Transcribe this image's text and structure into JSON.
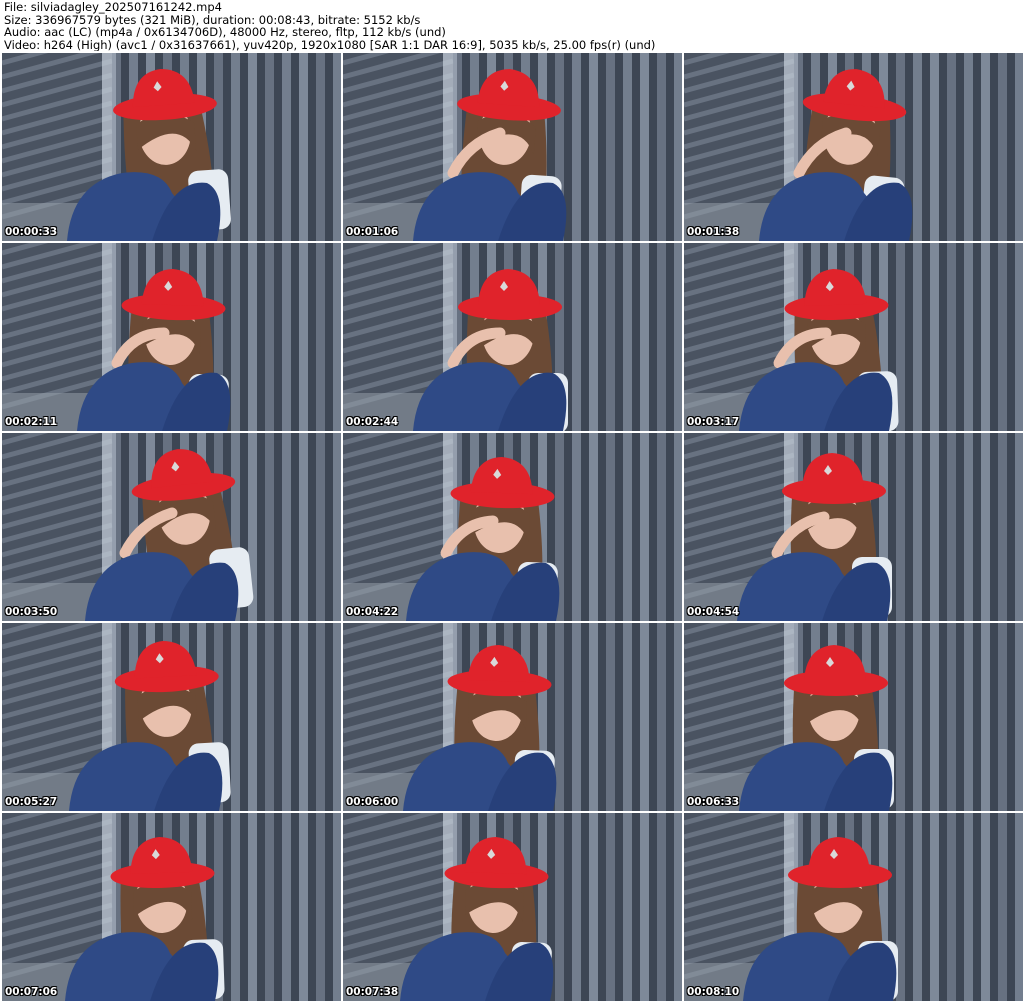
{
  "header": {
    "file_line": "File: silviadagley_202507161242.mp4",
    "size_line": "Size: 336967579 bytes (321 MiB), duration: 00:08:43, bitrate: 5152 kb/s",
    "audio_line": "Audio: aac (LC) (mp4a / 0x6134706D), 48000 Hz, stereo, fltp, 112 kb/s (und)",
    "video_line": "Video: h264 (High) (avc1 / 0x31637661), yuv420p, 1920x1080 [SAR 1:1 DAR 16:9], 5035 kb/s, 25.00 fps(r) (und)"
  },
  "thumbnails": [
    {
      "timestamp": "00:00:33"
    },
    {
      "timestamp": "00:01:06"
    },
    {
      "timestamp": "00:01:38"
    },
    {
      "timestamp": "00:02:11"
    },
    {
      "timestamp": "00:02:44"
    },
    {
      "timestamp": "00:03:17"
    },
    {
      "timestamp": "00:03:50"
    },
    {
      "timestamp": "00:04:22"
    },
    {
      "timestamp": "00:04:54"
    },
    {
      "timestamp": "00:05:27"
    },
    {
      "timestamp": "00:06:00"
    },
    {
      "timestamp": "00:06:33"
    },
    {
      "timestamp": "00:07:06"
    },
    {
      "timestamp": "00:07:38"
    },
    {
      "timestamp": "00:08:10"
    }
  ],
  "colors": {
    "curtain_light": "#8a95a6",
    "curtain_dark": "#3d4654",
    "hat": "#e0232b",
    "jeans": "#2f4a86",
    "hair": "#6b4a35",
    "skin": "#e8c0ad",
    "shirt": "#e6ecf2",
    "timestamp_text": "#ffffff"
  }
}
